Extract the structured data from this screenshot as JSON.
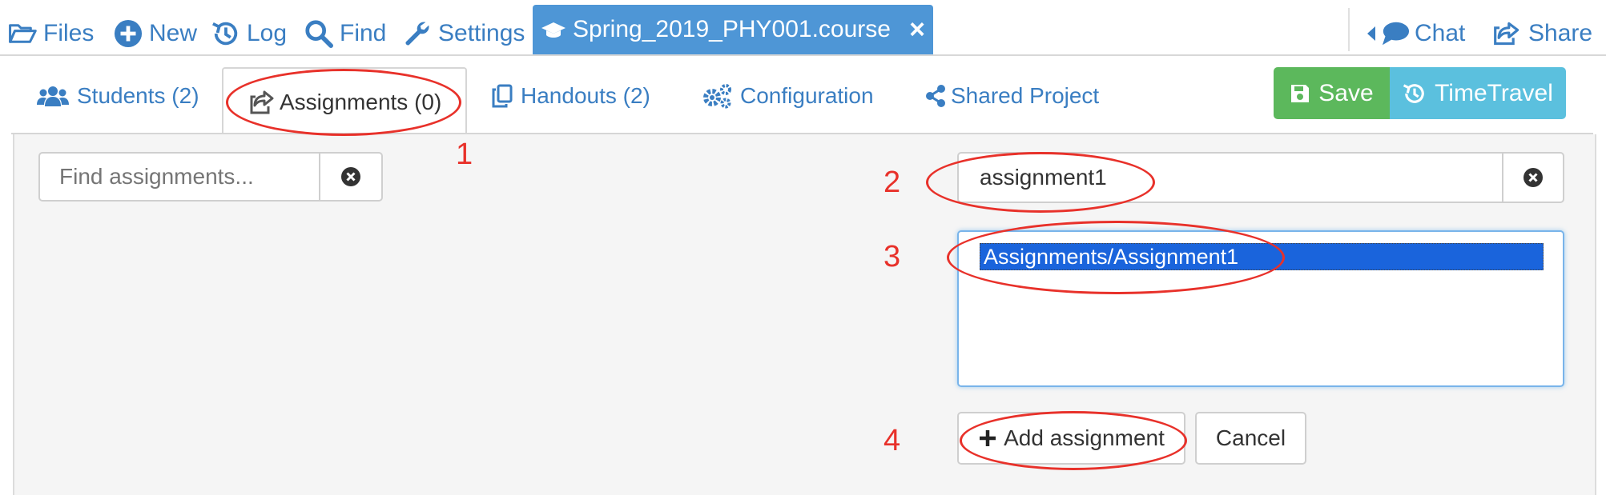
{
  "topbar": {
    "files": "Files",
    "new": "New",
    "log": "Log",
    "find": "Find",
    "settings": "Settings",
    "file_tab": "Spring_2019_PHY001.course",
    "close": "×",
    "chat": "Chat",
    "share": "Share"
  },
  "tabs": {
    "students": "Students (2)",
    "assignments": "Assignments (0)",
    "handouts": "Handouts (2)",
    "configuration": "Configuration",
    "shared_project": "Shared Project"
  },
  "actions": {
    "save": "Save",
    "timetravel": "TimeTravel"
  },
  "search": {
    "placeholder": "Find assignments..."
  },
  "add_form": {
    "name_value": "assignment1",
    "path_option": "Assignments/Assignment1",
    "add_button": "Add assignment",
    "cancel_button": "Cancel"
  },
  "annotations": [
    "1",
    "2",
    "3",
    "4"
  ],
  "colors": {
    "link_blue": "#3a7ec2",
    "tab_active_bg": "#4e96d6",
    "save_green": "#5cb85c",
    "timetravel_cyan": "#5bc0de",
    "selection_blue": "#1a64dc",
    "annotation_red": "#e8312a"
  },
  "icons": [
    "folder-open-icon",
    "plus-circle-icon",
    "history-icon",
    "search-icon",
    "wrench-icon",
    "graduation-cap-icon",
    "close-icon",
    "caret-left-icon",
    "comment-icon",
    "share-icon",
    "users-icon",
    "share-square-icon",
    "copy-icon",
    "cogs-icon",
    "share-alt-icon",
    "save-icon",
    "clear-circle-icon",
    "plus-icon"
  ]
}
